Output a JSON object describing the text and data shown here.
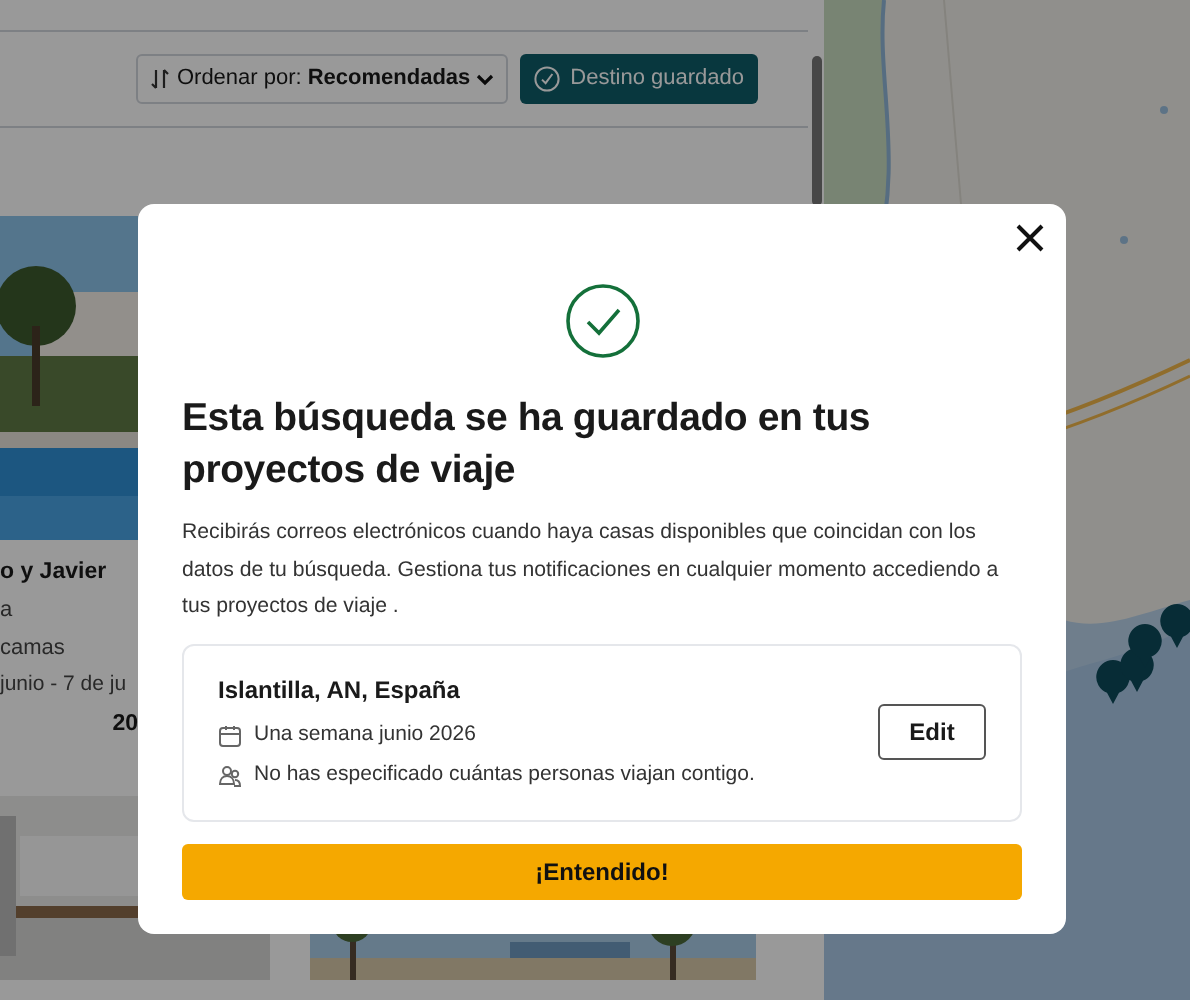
{
  "toolbar": {
    "sort_label": "Ordenar por:",
    "sort_value": "Recomendadas",
    "saved_button": "Destino guardado"
  },
  "listings": [
    {
      "kind": "picture",
      "title": "o y Javier",
      "line_2": "a",
      "line_3": "camas",
      "dates": "junio - 7 de ju",
      "price": "20"
    }
  ],
  "modal": {
    "title": "Esta búsqueda se ha guardado en tus proyectos de viaje",
    "body": "Recibirás correos electrónicos cuando haya casas disponibles que coincidan con los datos de tu búsqueda. Gestiona tus notificaciones en cualquier momento accediendo a tus proyectos de viaje .",
    "search": {
      "location": "Islantilla, AN, España",
      "dates": "Una semana junio 2026",
      "guests": "No has especificado cuántas personas viajan contigo."
    },
    "edit_button": "Edit",
    "confirm_button": "¡Entendido!"
  }
}
